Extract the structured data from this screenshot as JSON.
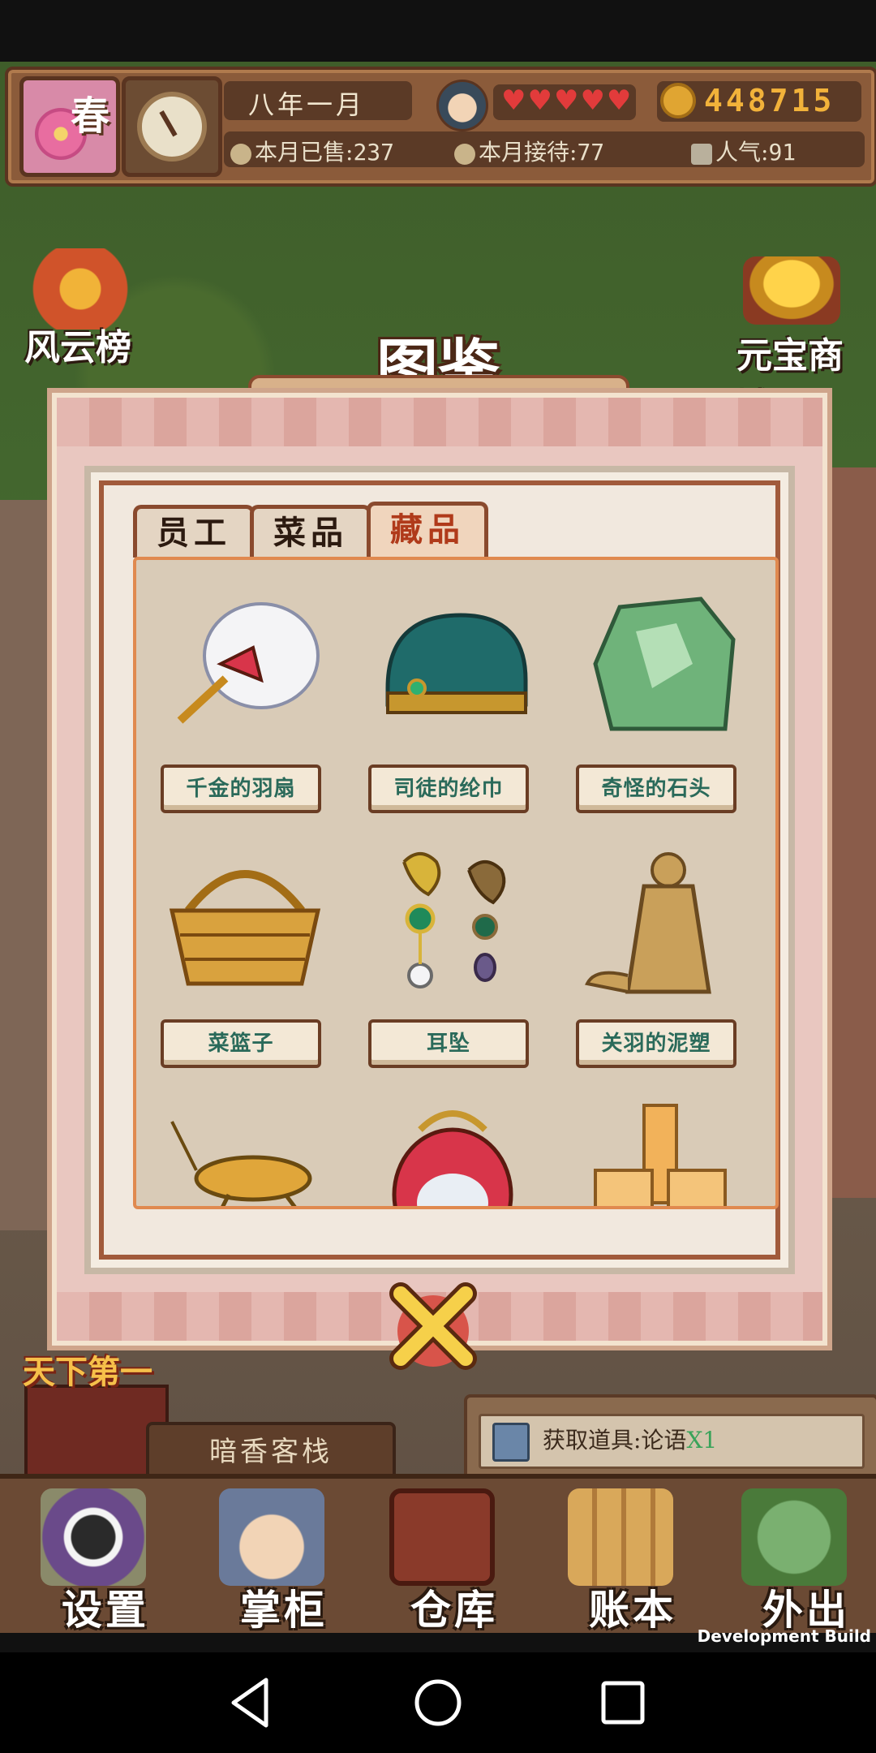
{
  "hud": {
    "season": "春",
    "date": "八年一月",
    "hearts": "♥♥♥♥♥",
    "coins": "448715",
    "sold_label": "本月已售:",
    "sold_value": "237",
    "served_label": "本月接待:",
    "served_value": "77",
    "popularity_label": "人气:",
    "popularity_value": "91"
  },
  "side": {
    "leaderboard": "风云榜",
    "shop": "元宝商城"
  },
  "modal": {
    "title": "图鉴",
    "tabs": [
      {
        "label": "员工",
        "active": false
      },
      {
        "label": "菜品",
        "active": false
      },
      {
        "label": "藏品",
        "active": true
      }
    ],
    "items": [
      {
        "label": "千金的羽扇",
        "icon": "feather-fan-icon"
      },
      {
        "label": "司徒的纶巾",
        "icon": "headscarf-icon"
      },
      {
        "label": "奇怪的石头",
        "icon": "jade-stone-icon"
      },
      {
        "label": "菜篮子",
        "icon": "basket-icon"
      },
      {
        "label": "耳坠",
        "icon": "earrings-icon"
      },
      {
        "label": "关羽的泥塑",
        "icon": "clay-statue-icon"
      },
      {
        "label": "",
        "icon": "cricket-icon"
      },
      {
        "label": "",
        "icon": "lantern-icon"
      },
      {
        "label": "",
        "icon": "gold-blocks-icon"
      }
    ]
  },
  "bottom": {
    "rank_title": "天下第一",
    "inn_name": "暗香客栈",
    "notification": "获取道具:论语",
    "notification_qty": "X1"
  },
  "menu": [
    {
      "label": "设置",
      "icon": "yin-yang-icon"
    },
    {
      "label": "掌柜",
      "icon": "shopkeeper-icon"
    },
    {
      "label": "仓库",
      "icon": "chest-icon"
    },
    {
      "label": "账本",
      "icon": "scrolls-icon"
    },
    {
      "label": "外出",
      "icon": "bundle-icon"
    }
  ],
  "dev_build": "Development Build",
  "colors": {
    "accent_active_tab": "#b03a1a",
    "item_label_text": "#2a6a5a",
    "coin": "#f2b23a"
  }
}
